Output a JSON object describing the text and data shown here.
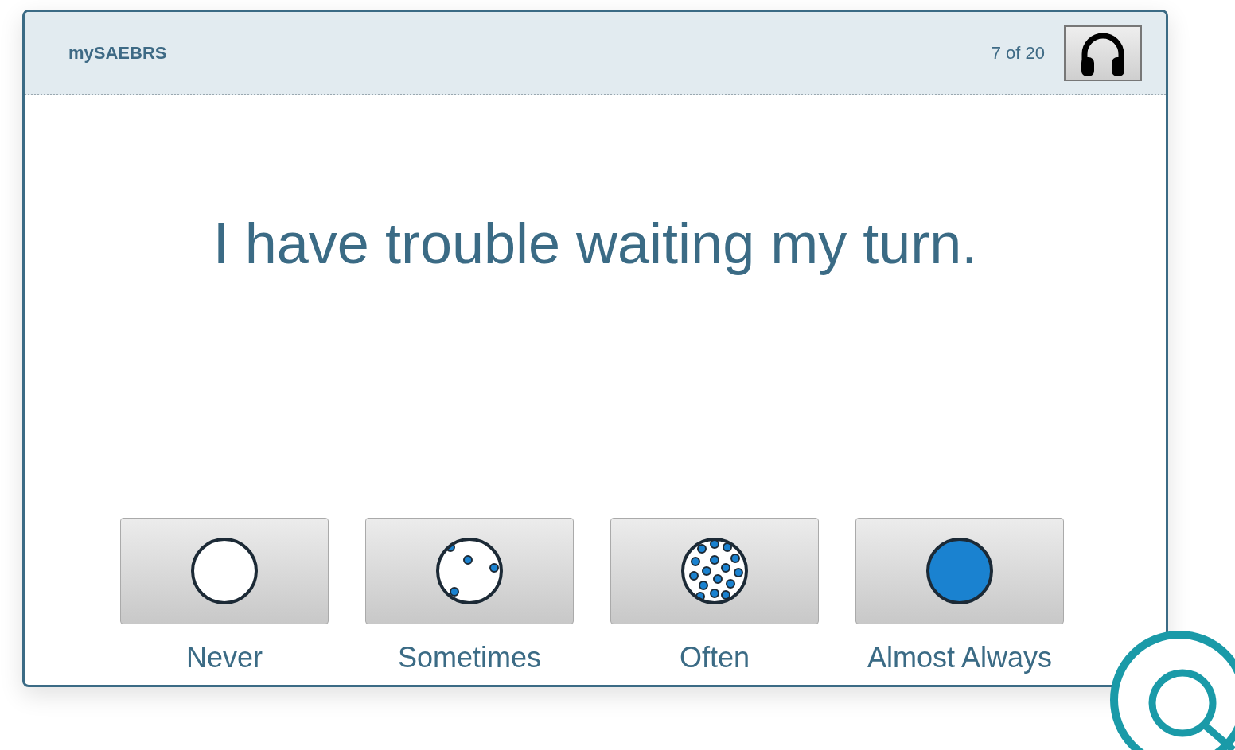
{
  "header": {
    "brand": "mySAEBRS",
    "progress": "7 of 20"
  },
  "question": "I have trouble waiting my turn.",
  "options": [
    {
      "label": "Never",
      "kind": "never"
    },
    {
      "label": "Sometimes",
      "kind": "sometimes"
    },
    {
      "label": "Often",
      "kind": "often"
    },
    {
      "label": "Almost Always",
      "kind": "always"
    }
  ]
}
